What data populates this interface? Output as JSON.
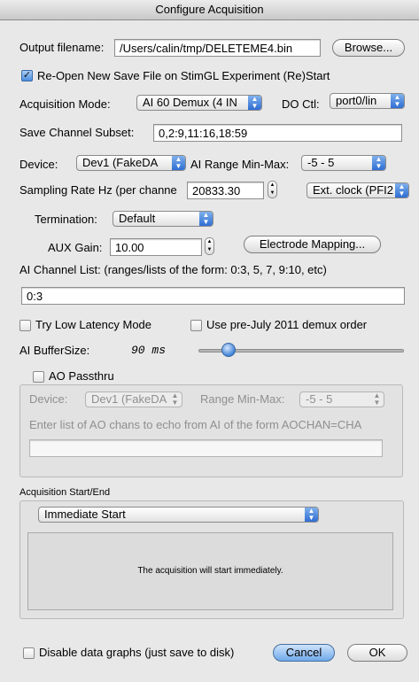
{
  "window": {
    "title": "Configure Acquisition"
  },
  "output": {
    "label": "Output filename:",
    "value": "/Users/calin/tmp/DELETEME4.bin",
    "browse": "Browse..."
  },
  "reopen": {
    "label": "Re-Open New Save File on StimGL Experiment (Re)Start",
    "checked": true
  },
  "acq_mode": {
    "label": "Acquisition Mode:",
    "value": "AI 60 Demux (4 IN"
  },
  "do_ctl": {
    "label": "DO Ctl:",
    "value": "port0/lin"
  },
  "save_subset": {
    "label": "Save Channel Subset:",
    "value": "0,2:9,11:16,18:59"
  },
  "device": {
    "label": "Device:",
    "value": "Dev1 (FakeDA"
  },
  "ai_range": {
    "label": "AI Range Min-Max:",
    "value": "-5 - 5"
  },
  "sampling": {
    "label": "Sampling Rate Hz (per channe",
    "value": "20833.30",
    "clock": "Ext. clock (PFI2"
  },
  "termination": {
    "label": "Termination:",
    "value": "Default"
  },
  "aux_gain": {
    "label": "AUX Gain:",
    "value": "10.00"
  },
  "electrode_mapping": {
    "label": "Electrode Mapping..."
  },
  "ai_chan_list": {
    "label": "AI Channel List: (ranges/lists of the form: 0:3, 5, 7, 9:10, etc)",
    "value": "0:3"
  },
  "low_latency": {
    "label": "Try Low Latency Mode",
    "checked": false
  },
  "pre_july": {
    "label": "Use pre-July 2011 demux order",
    "checked": false
  },
  "buffer": {
    "label": "AI BufferSize:",
    "value": "90 ms",
    "slider_fraction": 0.12
  },
  "ao": {
    "passthru_label": "AO Passthru",
    "passthru_checked": false,
    "device_label": "Device:",
    "device_value": "Dev1 (FakeDA",
    "range_label": "Range Min-Max:",
    "range_value": "-5 - 5",
    "instructions": "Enter list of AO chans to echo from AI of the form AOCHAN=CHA",
    "chan_value": ""
  },
  "acq_start": {
    "group_label": "Acquisition Start/End",
    "mode_value": "Immediate Start",
    "description": "The acquisition will start immediately."
  },
  "disable_graphs": {
    "label": "Disable data graphs (just save to disk)",
    "checked": false
  },
  "buttons": {
    "cancel": "Cancel",
    "ok": "OK"
  }
}
